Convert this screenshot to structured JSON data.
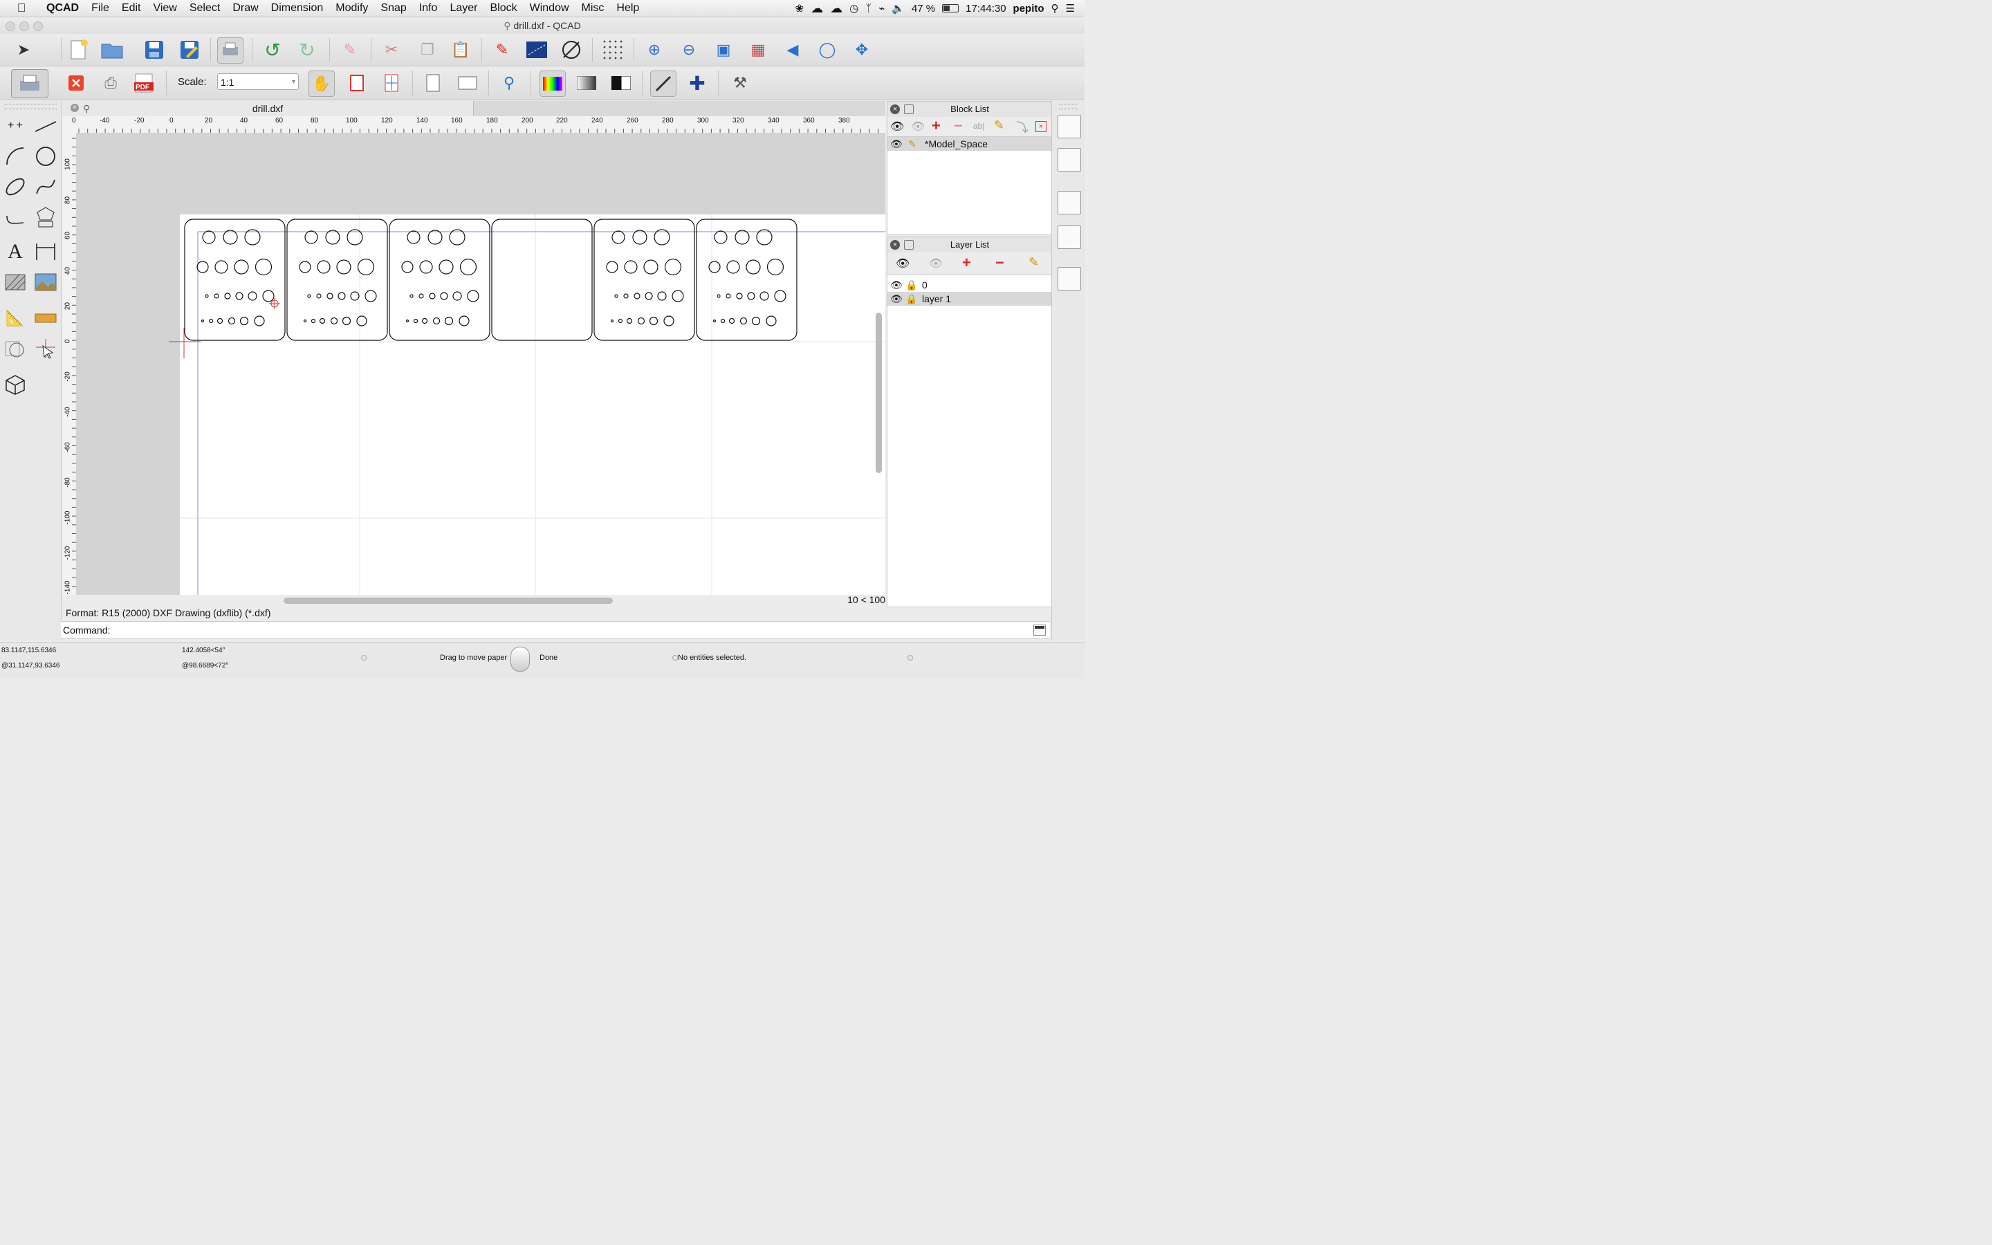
{
  "menubar": {
    "app_name": "QCAD",
    "items": [
      "File",
      "Edit",
      "View",
      "Select",
      "Draw",
      "Dimension",
      "Modify",
      "Snap",
      "Info",
      "Layer",
      "Block",
      "Window",
      "Misc",
      "Help"
    ],
    "battery": "47 %",
    "clock": "17:44:30",
    "user": "pepito"
  },
  "window": {
    "title": "drill.dxf - QCAD"
  },
  "toolbar2": {
    "scale_label": "Scale:",
    "scale_value": "1:1"
  },
  "document": {
    "tab_title": "drill.dxf",
    "ruler_h_labels": [
      "0",
      "-40",
      "-20",
      "0",
      "20",
      "40",
      "60",
      "80",
      "100",
      "120",
      "140",
      "160",
      "180",
      "200",
      "220",
      "240",
      "260",
      "280",
      "300",
      "320",
      "340",
      "360",
      "380"
    ],
    "ruler_v_labels": [
      "100",
      "80",
      "60",
      "40",
      "20",
      "0",
      "-20",
      "-40",
      "-60",
      "-80",
      "-100",
      "-120",
      "-140"
    ],
    "grid_info": "10 < 100"
  },
  "status": {
    "format": "Format: R15 (2000) DXF Drawing (dxflib) (*.dxf)",
    "command_label": "Command:"
  },
  "bottom": {
    "abs_coord": "83.1147,115.6346",
    "rel_coord": "@31.1147,93.6346",
    "polar_coord": "142.4058<54°",
    "rel_polar": "@98.6689<72°",
    "mouse_hint_left": "Drag to move paper",
    "mouse_hint_right": "Done",
    "selection": "No entities selected."
  },
  "block_list": {
    "title": "Block List",
    "items": [
      {
        "name": "*Model_Space"
      }
    ]
  },
  "layer_list": {
    "title": "Layer List",
    "items": [
      {
        "name": "0"
      },
      {
        "name": "layer 1"
      }
    ]
  },
  "colors": {
    "accent_blue": "#1f5fd6",
    "canvas_gray": "#d3d3d3",
    "paper_white": "#ffffff"
  }
}
